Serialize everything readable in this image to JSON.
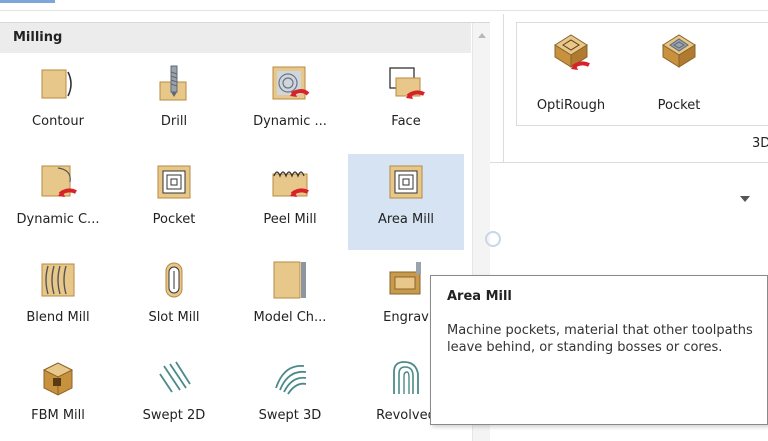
{
  "gallery": {
    "header": "Milling",
    "items": [
      {
        "label": "Contour",
        "icon": "contour-icon"
      },
      {
        "label": "Drill",
        "icon": "drill-icon"
      },
      {
        "label": "Dynamic ...",
        "icon": "dynamic-mill-icon"
      },
      {
        "label": "Face",
        "icon": "face-icon"
      },
      {
        "label": "Dynamic C...",
        "icon": "dynamic-contour-icon"
      },
      {
        "label": "Pocket",
        "icon": "pocket-icon"
      },
      {
        "label": "Peel Mill",
        "icon": "peel-mill-icon"
      },
      {
        "label": "Area Mill",
        "icon": "area-mill-icon",
        "selected": true
      },
      {
        "label": "Blend Mill",
        "icon": "blend-mill-icon"
      },
      {
        "label": "Slot Mill",
        "icon": "slot-mill-icon"
      },
      {
        "label": "Model Ch...",
        "icon": "model-chamfer-icon"
      },
      {
        "label": "Engrav",
        "icon": "engrave-icon"
      },
      {
        "label": "FBM Mill",
        "icon": "fbm-mill-icon"
      },
      {
        "label": "Swept 2D",
        "icon": "swept-2d-icon"
      },
      {
        "label": "Swept 3D",
        "icon": "swept-3d-icon"
      },
      {
        "label": "Revolved",
        "icon": "revolved-icon"
      }
    ]
  },
  "ribbon": {
    "items": [
      {
        "label": "OptiRough",
        "icon": "optirough-icon"
      },
      {
        "label": "Pocket",
        "icon": "pocket-3d-icon"
      }
    ],
    "group_label": "3D"
  },
  "tooltip": {
    "title": "Area Mill",
    "body": "Machine pockets, material that other toolpaths leave behind, or standing bosses or cores."
  },
  "colors": {
    "selection": "#d5e3f2",
    "stock": "#e8c88a",
    "stock_edge": "#b88a3e",
    "arrow_red": "#d8222a"
  }
}
